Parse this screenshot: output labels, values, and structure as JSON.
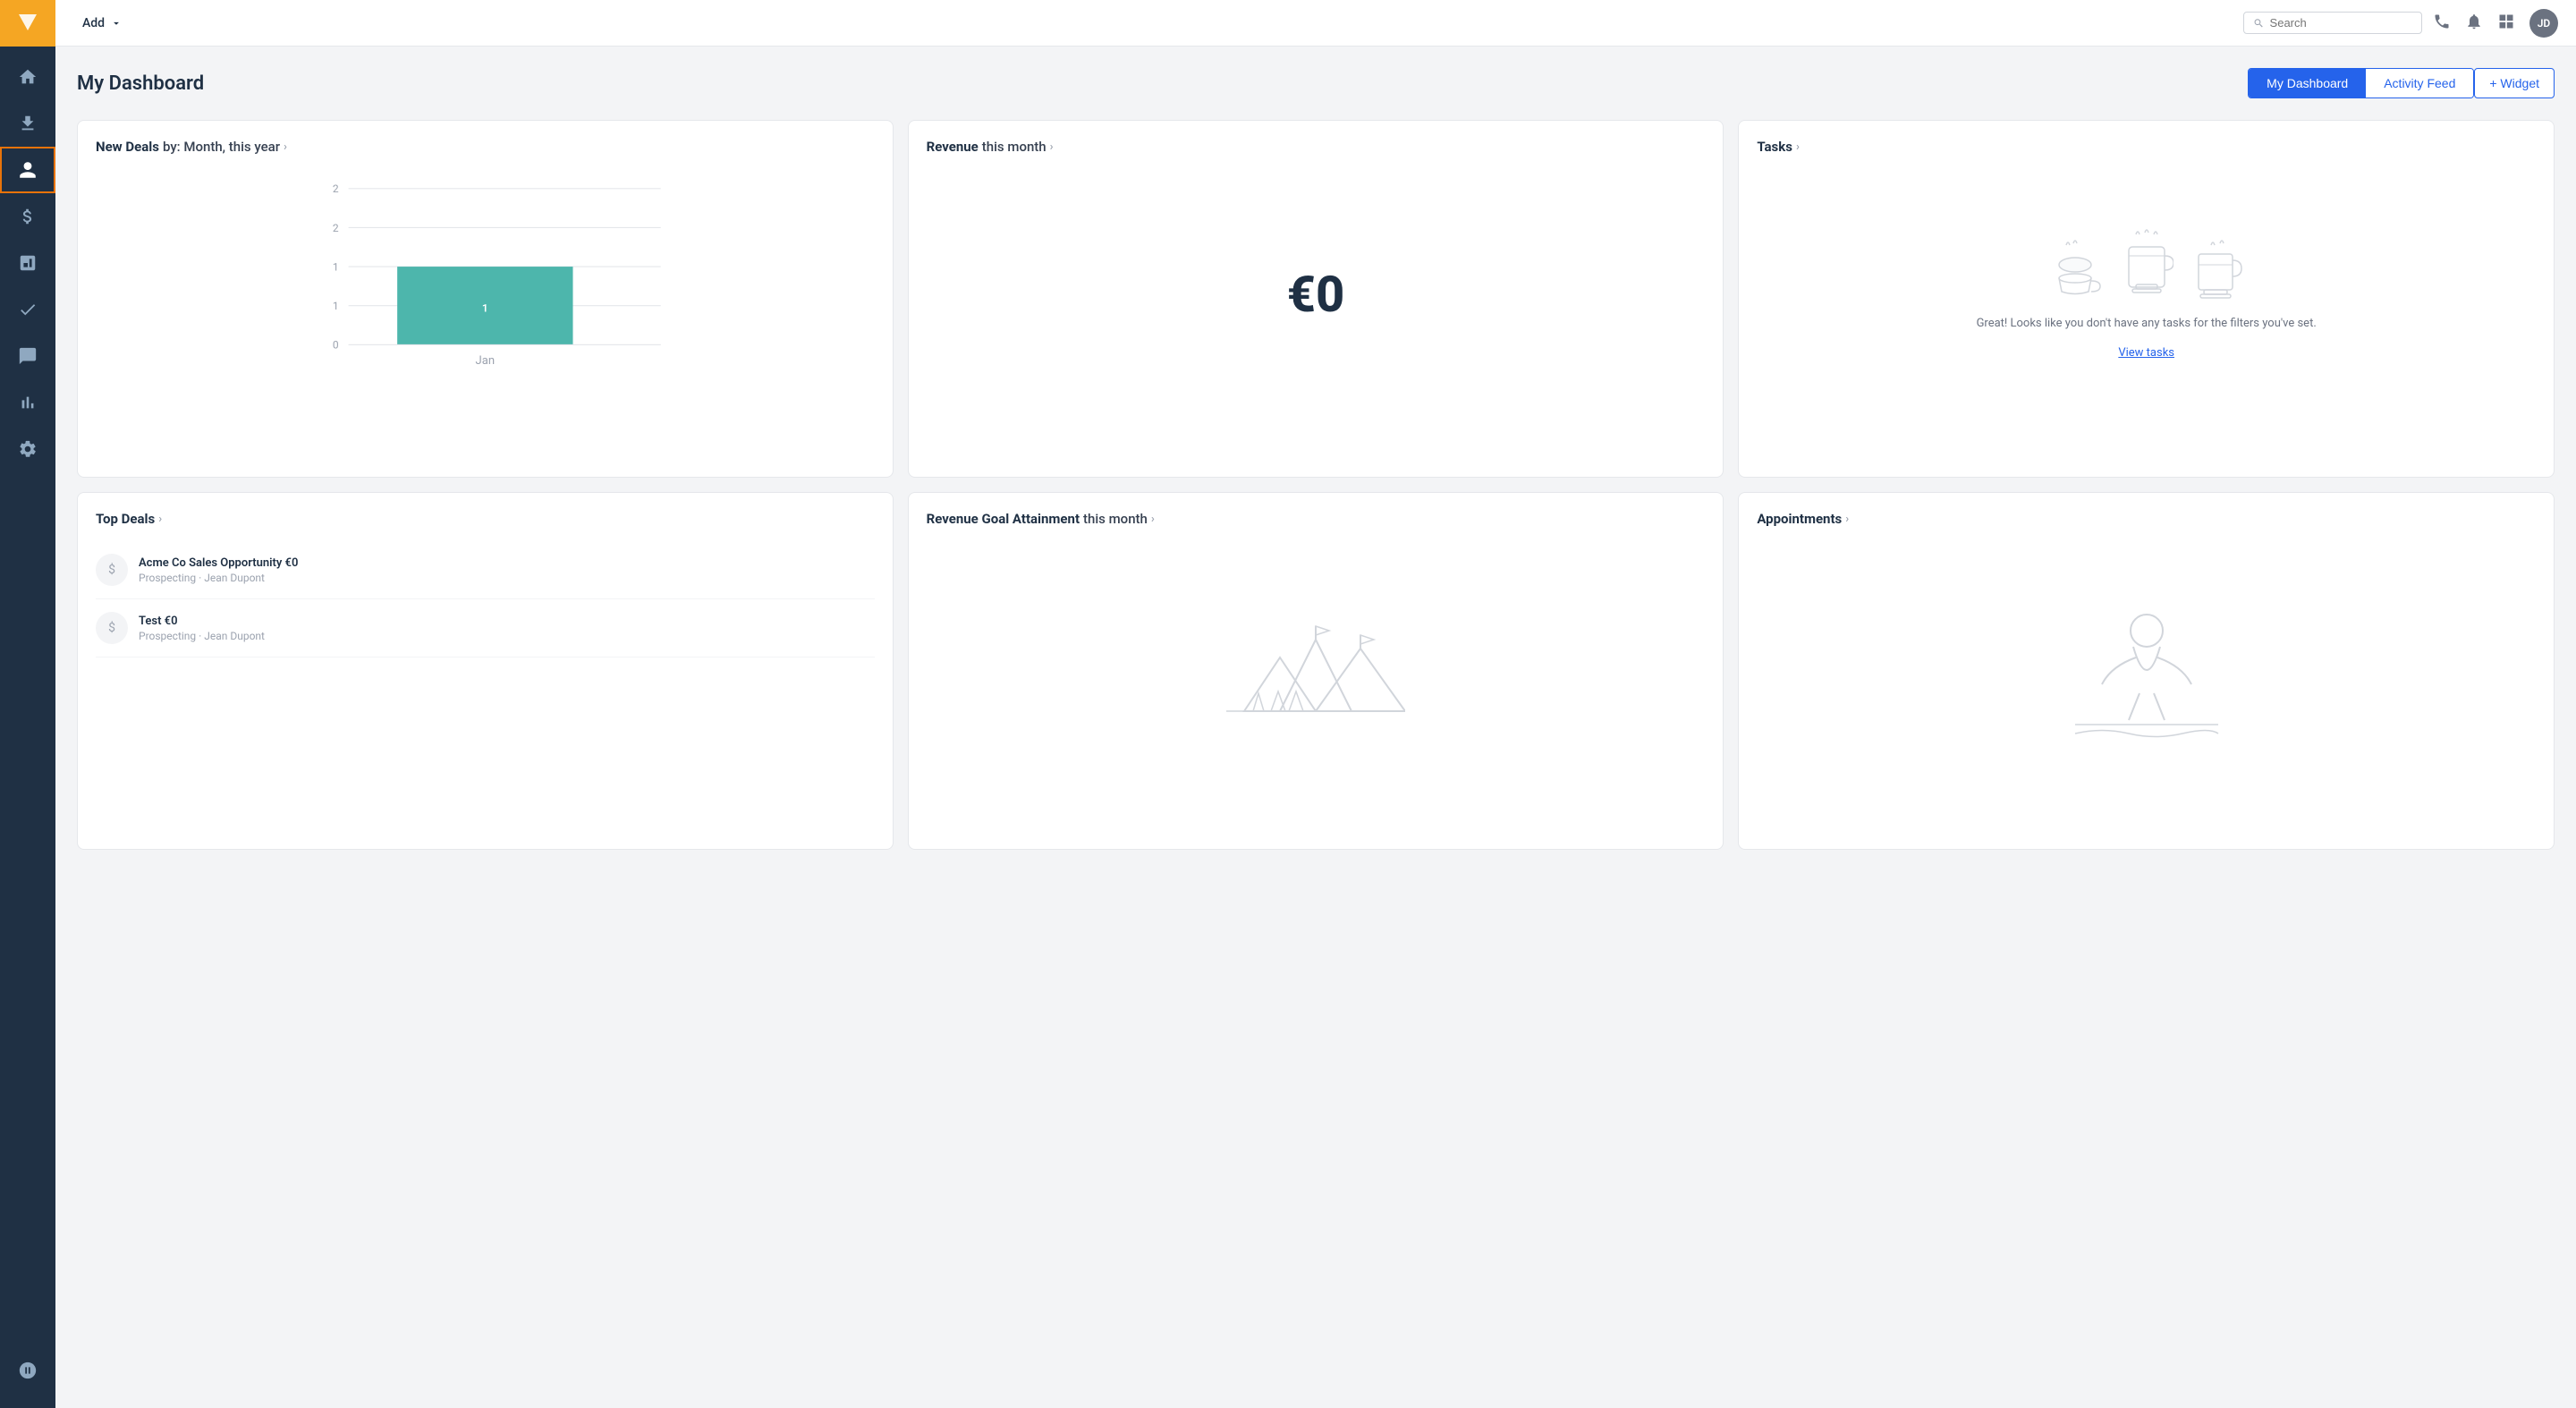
{
  "topbar": {
    "add_label": "Add",
    "search_placeholder": "Search",
    "avatar_initials": "JD"
  },
  "page": {
    "title": "My Dashboard"
  },
  "tabs": [
    {
      "id": "my-dashboard",
      "label": "My Dashboard",
      "active": true
    },
    {
      "id": "activity-feed",
      "label": "Activity Feed",
      "active": false
    }
  ],
  "add_widget_label": "+ Widget",
  "widgets": {
    "new_deals": {
      "title_bold": "New Deals",
      "title_rest": " by: Month, this year",
      "chart": {
        "y_labels": [
          "2",
          "2",
          "1",
          "1",
          "0"
        ],
        "bar_value": "1",
        "x_label": "Jan"
      }
    },
    "revenue": {
      "title_bold": "Revenue",
      "title_rest": " this month",
      "value": "€0"
    },
    "tasks": {
      "title": "Tasks",
      "empty_msg": "Great! Looks like you don't have any tasks for the filters you've set.",
      "view_link": "View tasks"
    },
    "top_deals": {
      "title": "Top Deals",
      "deals": [
        {
          "name": "Acme Co Sales Opportunity €0",
          "sub": "Prospecting · Jean Dupont"
        },
        {
          "name": "Test €0",
          "sub": "Prospecting · Jean Dupont"
        }
      ]
    },
    "revenue_goal": {
      "title_bold": "Revenue Goal Attainment",
      "title_rest": " this month"
    },
    "appointments": {
      "title": "Appointments"
    }
  },
  "sidebar": {
    "items": [
      {
        "id": "home",
        "icon": "home"
      },
      {
        "id": "download",
        "icon": "download"
      },
      {
        "id": "person",
        "icon": "person",
        "active": true
      },
      {
        "id": "dollar",
        "icon": "dollar"
      },
      {
        "id": "chart-bar",
        "icon": "chart-bar"
      },
      {
        "id": "check",
        "icon": "check"
      },
      {
        "id": "chat",
        "icon": "chat"
      },
      {
        "id": "analytics",
        "icon": "analytics"
      },
      {
        "id": "settings",
        "icon": "settings"
      }
    ],
    "bottom_items": [
      {
        "id": "zendesk",
        "icon": "zendesk"
      }
    ]
  }
}
